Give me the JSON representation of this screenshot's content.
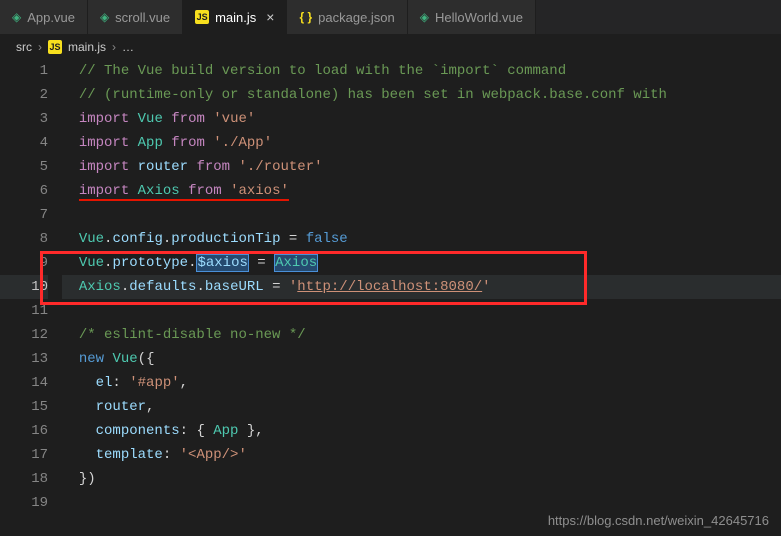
{
  "tabs": [
    {
      "label": "App.vue",
      "icon": "vue"
    },
    {
      "label": "scroll.vue",
      "icon": "vue"
    },
    {
      "label": "main.js",
      "icon": "js",
      "active": true
    },
    {
      "label": "package.json",
      "icon": "json"
    },
    {
      "label": "HelloWorld.vue",
      "icon": "vue"
    }
  ],
  "close_icon": "×",
  "breadcrumb": {
    "root": "src",
    "file": "main.js",
    "tail": "…",
    "sep": "›"
  },
  "lines": [
    "1",
    "2",
    "3",
    "4",
    "5",
    "6",
    "7",
    "8",
    "9",
    "10",
    "11",
    "12",
    "13",
    "14",
    "15",
    "16",
    "17",
    "18",
    "19"
  ],
  "code": {
    "c1": "// The Vue build version to load with the `import` command",
    "c2": "// (runtime-only or standalone) has been set in webpack.base.conf with ",
    "import": "import",
    "from": "from",
    "new": "new",
    "vue": "Vue",
    "app": "App",
    "router": "router",
    "axios": "Axios",
    "str_vue": "'vue'",
    "str_app": "'./App'",
    "str_router": "'./router'",
    "str_axios": "'axios'",
    "config": "config",
    "productionTip": "productionTip",
    "prototype": "prototype",
    "saxios": "$axios",
    "defaults": "defaults",
    "baseURL": "baseURL",
    "false": "false",
    "url_q1": "'",
    "url": "http://localhost:8080/",
    "url_q2": "'",
    "eslint": "/* eslint-disable no-new */",
    "el": "el",
    "str_hash": "'#app'",
    "components": "components",
    "template": "template",
    "str_tpl": "'<App/>'",
    "eq": " = ",
    "dot": ".",
    "comma": ",",
    "colon": ": ",
    "lbrace": "{",
    "rbrace": "}",
    "lparen": "(",
    "rparen": ")",
    "sp2": "  ",
    "sp4": "    "
  },
  "watermark": "https://blog.csdn.net/weixin_42645716"
}
